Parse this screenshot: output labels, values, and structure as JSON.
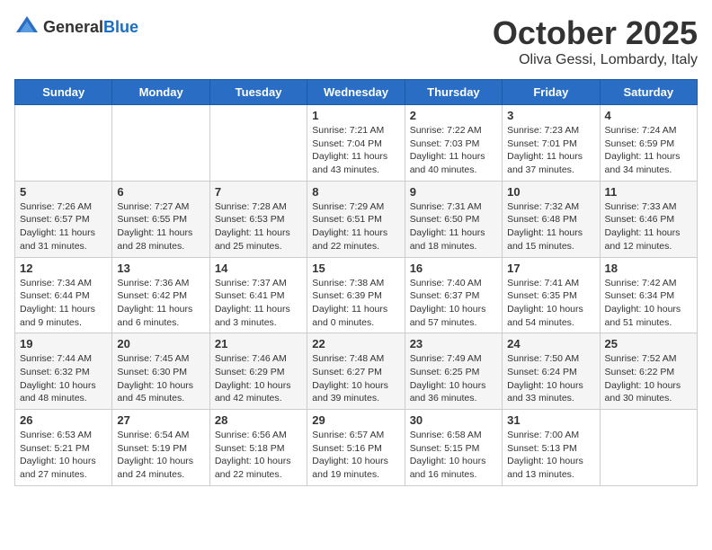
{
  "header": {
    "logo": {
      "general": "General",
      "blue": "Blue"
    },
    "month": "October 2025",
    "location": "Oliva Gessi, Lombardy, Italy"
  },
  "weekdays": [
    "Sunday",
    "Monday",
    "Tuesday",
    "Wednesday",
    "Thursday",
    "Friday",
    "Saturday"
  ],
  "weeks": [
    [
      {
        "day": "",
        "info": ""
      },
      {
        "day": "",
        "info": ""
      },
      {
        "day": "",
        "info": ""
      },
      {
        "day": "1",
        "info": "Sunrise: 7:21 AM\nSunset: 7:04 PM\nDaylight: 11 hours and 43 minutes."
      },
      {
        "day": "2",
        "info": "Sunrise: 7:22 AM\nSunset: 7:03 PM\nDaylight: 11 hours and 40 minutes."
      },
      {
        "day": "3",
        "info": "Sunrise: 7:23 AM\nSunset: 7:01 PM\nDaylight: 11 hours and 37 minutes."
      },
      {
        "day": "4",
        "info": "Sunrise: 7:24 AM\nSunset: 6:59 PM\nDaylight: 11 hours and 34 minutes."
      }
    ],
    [
      {
        "day": "5",
        "info": "Sunrise: 7:26 AM\nSunset: 6:57 PM\nDaylight: 11 hours and 31 minutes."
      },
      {
        "day": "6",
        "info": "Sunrise: 7:27 AM\nSunset: 6:55 PM\nDaylight: 11 hours and 28 minutes."
      },
      {
        "day": "7",
        "info": "Sunrise: 7:28 AM\nSunset: 6:53 PM\nDaylight: 11 hours and 25 minutes."
      },
      {
        "day": "8",
        "info": "Sunrise: 7:29 AM\nSunset: 6:51 PM\nDaylight: 11 hours and 22 minutes."
      },
      {
        "day": "9",
        "info": "Sunrise: 7:31 AM\nSunset: 6:50 PM\nDaylight: 11 hours and 18 minutes."
      },
      {
        "day": "10",
        "info": "Sunrise: 7:32 AM\nSunset: 6:48 PM\nDaylight: 11 hours and 15 minutes."
      },
      {
        "day": "11",
        "info": "Sunrise: 7:33 AM\nSunset: 6:46 PM\nDaylight: 11 hours and 12 minutes."
      }
    ],
    [
      {
        "day": "12",
        "info": "Sunrise: 7:34 AM\nSunset: 6:44 PM\nDaylight: 11 hours and 9 minutes."
      },
      {
        "day": "13",
        "info": "Sunrise: 7:36 AM\nSunset: 6:42 PM\nDaylight: 11 hours and 6 minutes."
      },
      {
        "day": "14",
        "info": "Sunrise: 7:37 AM\nSunset: 6:41 PM\nDaylight: 11 hours and 3 minutes."
      },
      {
        "day": "15",
        "info": "Sunrise: 7:38 AM\nSunset: 6:39 PM\nDaylight: 11 hours and 0 minutes."
      },
      {
        "day": "16",
        "info": "Sunrise: 7:40 AM\nSunset: 6:37 PM\nDaylight: 10 hours and 57 minutes."
      },
      {
        "day": "17",
        "info": "Sunrise: 7:41 AM\nSunset: 6:35 PM\nDaylight: 10 hours and 54 minutes."
      },
      {
        "day": "18",
        "info": "Sunrise: 7:42 AM\nSunset: 6:34 PM\nDaylight: 10 hours and 51 minutes."
      }
    ],
    [
      {
        "day": "19",
        "info": "Sunrise: 7:44 AM\nSunset: 6:32 PM\nDaylight: 10 hours and 48 minutes."
      },
      {
        "day": "20",
        "info": "Sunrise: 7:45 AM\nSunset: 6:30 PM\nDaylight: 10 hours and 45 minutes."
      },
      {
        "day": "21",
        "info": "Sunrise: 7:46 AM\nSunset: 6:29 PM\nDaylight: 10 hours and 42 minutes."
      },
      {
        "day": "22",
        "info": "Sunrise: 7:48 AM\nSunset: 6:27 PM\nDaylight: 10 hours and 39 minutes."
      },
      {
        "day": "23",
        "info": "Sunrise: 7:49 AM\nSunset: 6:25 PM\nDaylight: 10 hours and 36 minutes."
      },
      {
        "day": "24",
        "info": "Sunrise: 7:50 AM\nSunset: 6:24 PM\nDaylight: 10 hours and 33 minutes."
      },
      {
        "day": "25",
        "info": "Sunrise: 7:52 AM\nSunset: 6:22 PM\nDaylight: 10 hours and 30 minutes."
      }
    ],
    [
      {
        "day": "26",
        "info": "Sunrise: 6:53 AM\nSunset: 5:21 PM\nDaylight: 10 hours and 27 minutes."
      },
      {
        "day": "27",
        "info": "Sunrise: 6:54 AM\nSunset: 5:19 PM\nDaylight: 10 hours and 24 minutes."
      },
      {
        "day": "28",
        "info": "Sunrise: 6:56 AM\nSunset: 5:18 PM\nDaylight: 10 hours and 22 minutes."
      },
      {
        "day": "29",
        "info": "Sunrise: 6:57 AM\nSunset: 5:16 PM\nDaylight: 10 hours and 19 minutes."
      },
      {
        "day": "30",
        "info": "Sunrise: 6:58 AM\nSunset: 5:15 PM\nDaylight: 10 hours and 16 minutes."
      },
      {
        "day": "31",
        "info": "Sunrise: 7:00 AM\nSunset: 5:13 PM\nDaylight: 10 hours and 13 minutes."
      },
      {
        "day": "",
        "info": ""
      }
    ]
  ]
}
